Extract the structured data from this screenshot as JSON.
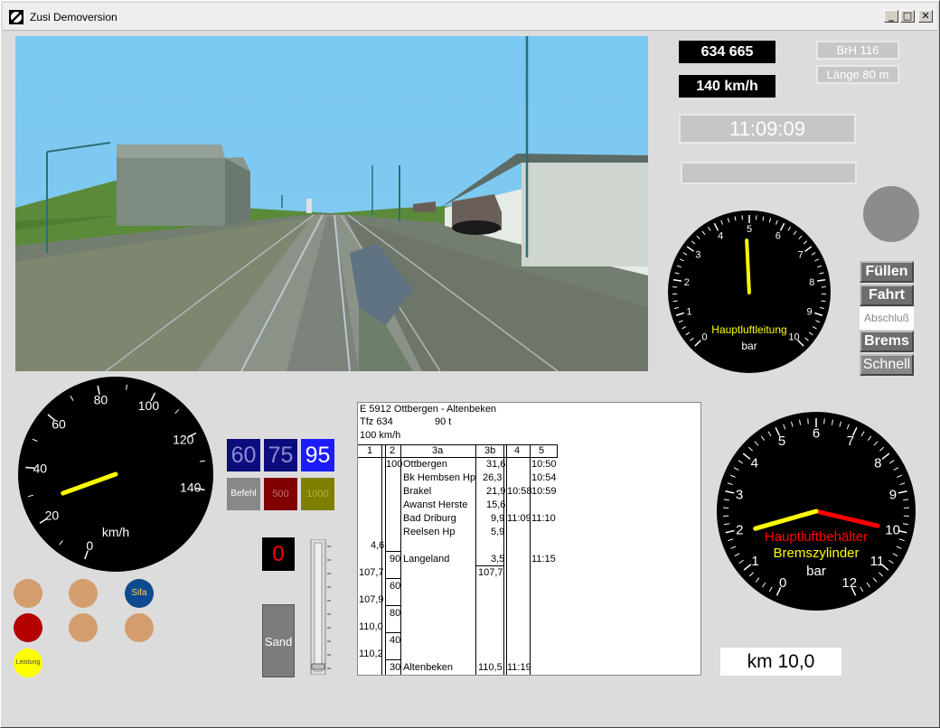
{
  "window": {
    "title": "Zusi Demoversion"
  },
  "titlebar_buttons": {
    "min": "_",
    "max": "□",
    "close": "✕"
  },
  "display": {
    "train_number": "634 665",
    "speed_limit": "140 km/h",
    "brh": "BrH 116",
    "length": "Länge 80 m",
    "clock": "11:09:09",
    "km": "km 10,0"
  },
  "brake_valve": {
    "buttons": [
      "Füllen",
      "Fahrt",
      "Abschluß",
      "Brems",
      "Schnell"
    ],
    "selected": "Abschluß"
  },
  "main_air_gauge": {
    "label": "Hauptluftleitung",
    "unit": "bar",
    "ticks": [
      "0",
      "1",
      "2",
      "3",
      "4",
      "5",
      "6",
      "7",
      "8",
      "9",
      "10"
    ],
    "value": 4.9,
    "needle_color": "#ffff00"
  },
  "speedometer": {
    "unit": "km/h",
    "ticks": [
      "0",
      "20",
      "40",
      "60",
      "80",
      "100",
      "120",
      "140"
    ],
    "value": 27,
    "needle_color": "#ffff00"
  },
  "brake_gauge": {
    "label_red": "Hauptluftbehälter",
    "label_yellow": "Bremszylinder",
    "unit": "bar",
    "ticks": [
      "0",
      "1",
      "2",
      "3",
      "4",
      "5",
      "6",
      "7",
      "8",
      "9",
      "10",
      "11",
      "12"
    ],
    "value_red": 10.0,
    "value_yellow": 1.9,
    "red_color": "#ff0000",
    "yellow_color": "#ffff00"
  },
  "pzb": {
    "speeds": [
      "60",
      "75",
      "95"
    ],
    "befehl": "Befehl",
    "b500": "500",
    "b1000": "1000"
  },
  "counter": "0",
  "sand": "Sand",
  "lamps": {
    "sifa": "Sifa",
    "leistung": "Leistung"
  },
  "timetable": {
    "header1": "E 5912  Ottbergen - Altenbeken",
    "header2_left": "Tfz 634",
    "header2_right": "90 t",
    "header3": "100 km/h",
    "columns": [
      "1",
      "2",
      "3a",
      "3b",
      "4",
      "5"
    ],
    "col2_values": [
      "100",
      "90",
      "60",
      "80",
      "40",
      "30"
    ],
    "col1_values": [
      "4,6",
      "107,7",
      "107,9",
      "110,0",
      "110,2"
    ],
    "stations": [
      {
        "name": "Ottbergen",
        "km": "31,6",
        "arr": "",
        "dep": "10:50"
      },
      {
        "name": "Bk Hembsen Hp",
        "km": "26,3",
        "arr": "",
        "dep": "10:54"
      },
      {
        "name": "Brakel",
        "km": "21,9",
        "arr": "10:58",
        "dep": "10:59"
      },
      {
        "name": "Awanst Herste",
        "km": "15,6",
        "arr": "",
        "dep": ""
      },
      {
        "name": "Bad Driburg",
        "km": "9,9",
        "arr": "11:09",
        "dep": "11:10"
      },
      {
        "name": "Reelsen Hp",
        "km": "5,9",
        "arr": "",
        "dep": ""
      },
      {
        "name": "Langeland",
        "km": "3,5",
        "arr": "",
        "dep": "11:15"
      },
      {
        "name": "Altenbeken",
        "km": "110,5",
        "arr": "11:19",
        "dep": ""
      }
    ],
    "extra_km": "107,7"
  }
}
